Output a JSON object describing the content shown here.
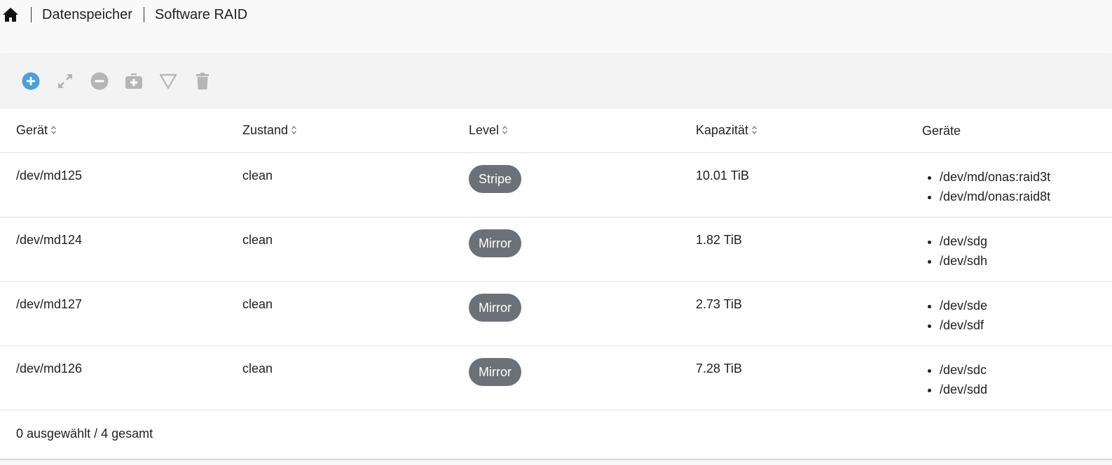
{
  "breadcrumb": {
    "home_icon": "home-icon",
    "items": [
      "Datenspeicher",
      "Software RAID"
    ]
  },
  "toolbar": {
    "buttons": [
      {
        "name": "create",
        "icon": "plus-circle-icon",
        "color": "#4a9fdc",
        "enabled": true
      },
      {
        "name": "grow",
        "icon": "expand-icon",
        "color": "#b5b5b5",
        "enabled": false
      },
      {
        "name": "remove",
        "icon": "minus-circle-icon",
        "color": "#b5b5b5",
        "enabled": false
      },
      {
        "name": "recover",
        "icon": "medkit-icon",
        "color": "#b5b5b5",
        "enabled": false
      },
      {
        "name": "filter",
        "icon": "filter-triangle-icon",
        "color": "#b5b5b5",
        "enabled": false
      },
      {
        "name": "delete",
        "icon": "trash-icon",
        "color": "#b5b5b5",
        "enabled": false
      }
    ]
  },
  "table": {
    "headers": {
      "device": "Gerät",
      "state": "Zustand",
      "level": "Level",
      "capacity": "Kapazität",
      "devices": "Geräte"
    },
    "rows": [
      {
        "device": "/dev/md125",
        "state": "clean",
        "level": "Stripe",
        "capacity": "10.01 TiB",
        "devices": [
          "/dev/md/onas:raid3t",
          "/dev/md/onas:raid8t"
        ]
      },
      {
        "device": "/dev/md124",
        "state": "clean",
        "level": "Mirror",
        "capacity": "1.82 TiB",
        "devices": [
          "/dev/sdg",
          "/dev/sdh"
        ]
      },
      {
        "device": "/dev/md127",
        "state": "clean",
        "level": "Mirror",
        "capacity": "2.73 TiB",
        "devices": [
          "/dev/sde",
          "/dev/sdf"
        ]
      },
      {
        "device": "/dev/md126",
        "state": "clean",
        "level": "Mirror",
        "capacity": "7.28 TiB",
        "devices": [
          "/dev/sdc",
          "/dev/sdd"
        ]
      }
    ]
  },
  "footer": {
    "summary": "0 ausgewählt / 4 gesamt"
  },
  "colors": {
    "accent": "#4a9fdc",
    "disabled_icon": "#b5b5b5",
    "badge_bg": "#6c7177"
  }
}
